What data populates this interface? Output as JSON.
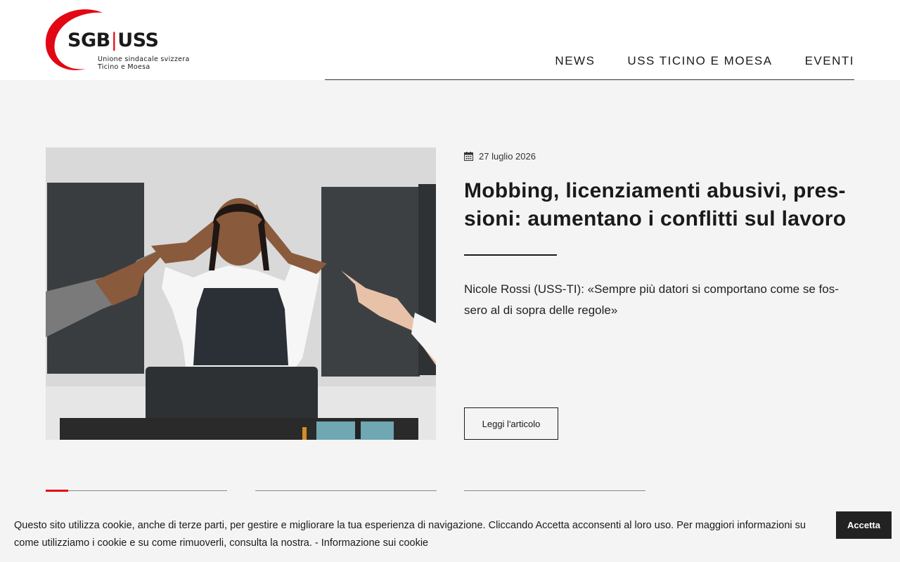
{
  "brand": {
    "wordmark_left": "SGB",
    "wordmark_sep": "|",
    "wordmark_right": "USS",
    "sub_line1": "Unione sindacale svizzera",
    "sub_line2": "Ticino e Moesa",
    "accent_color": "#e30613"
  },
  "nav": {
    "items": [
      {
        "label": "NEWS"
      },
      {
        "label": "USS TICINO E MOESA"
      },
      {
        "label": "EVENTI"
      }
    ]
  },
  "article": {
    "date_icon": "calendar-icon",
    "date": "27 luglio 2026",
    "title": "Mobbing, licenziamenti abusivi, pres-sioni: aumentano i conflitti sul lavoro",
    "lead": "Nicole Rossi (USS-TI): «Sempre più datori si comportano come se fos-sero al di sopra delle regole»",
    "read_more": "Leggi l'articolo",
    "image_alt": "Donna stressata con le mani sulla testa, indicata da altre mani"
  },
  "slider": {
    "active_index": 0
  },
  "cookie_banner": {
    "text": "Questo sito utilizza cookie, anche di terze parti, per gestire e migliorare la tua esperienza di navigazione. Cliccando Accetta acconsenti al loro uso. Per maggiori informazioni su come utilizziamo i cookie e su come rimuoverli, consulta la nostra. - ",
    "link": "Informazione sui cookie",
    "accept": "Accetta"
  }
}
